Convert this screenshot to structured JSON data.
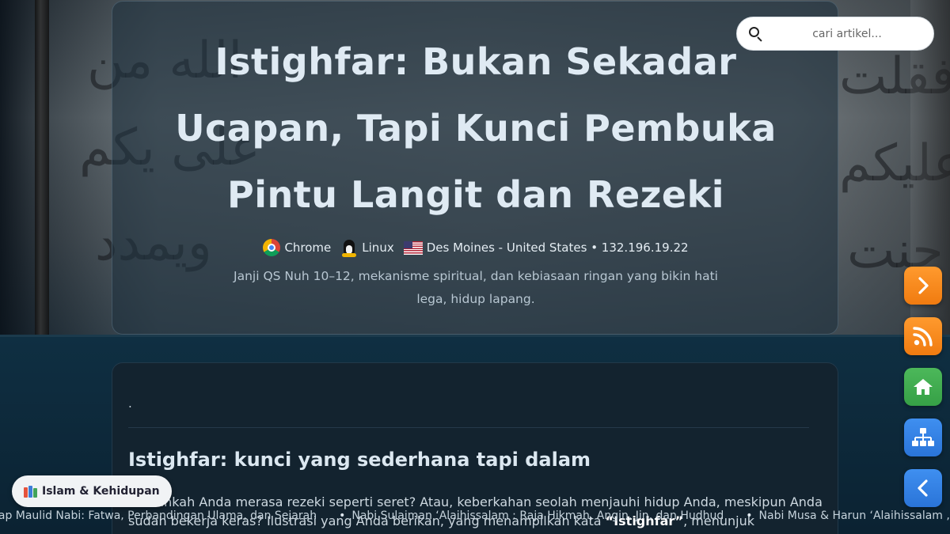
{
  "hero": {
    "title": "Istighfar: Bukan Sekadar Ucapan, Tapi Kunci Pembuka Pintu Langit dan Rezeki",
    "meta": {
      "browser": "Chrome",
      "os": "Linux",
      "location": "Des Moines - United States • 132.196.19.22"
    },
    "subtitle": "Janji QS Nuh 10–12, mekanisme spiritual, dan kebiasaan ringan yang bikin hati lega, hidup lapang."
  },
  "search": {
    "placeholder": "cari artikel..."
  },
  "side_buttons": {
    "next_icon": "chevron-right-icon",
    "rss_icon": "rss-icon",
    "home_icon": "home-icon",
    "sitemap_icon": "sitemap-icon",
    "back_icon": "chevron-left-icon"
  },
  "content": {
    "dot": ".",
    "heading": "Istighfar: kunci yang sederhana tapi dalam",
    "paragraph_before": "Pernahkah Anda merasa rezeki seperti seret? Atau, keberkahan seolah menjauhi hidup Anda, meskipun Anda sudah bekerja keras? Ilustrasi yang Anda berikan, yang menampilkan kata ",
    "paragraph_bold": "“Istighfar”",
    "paragraph_after": ", menunjuk"
  },
  "category": {
    "label": "Islam & Kehidupan",
    "icon": "books-icon"
  },
  "ticker": [
    "kap Maulid Nabi: Fatwa, Perbandingan Ulama, dan Sejarah",
    "Nabi Sulaiman ‘Alaihissalam : Raja Hikmah, Angin, Jin, dan Hudhud",
    "Nabi Musa & Harun ‘Alaihissalam , Ke"
  ],
  "colors": {
    "orange": "#f58a1f",
    "green": "#3fa94f",
    "blue": "#3582e6",
    "card": "#13232f"
  }
}
